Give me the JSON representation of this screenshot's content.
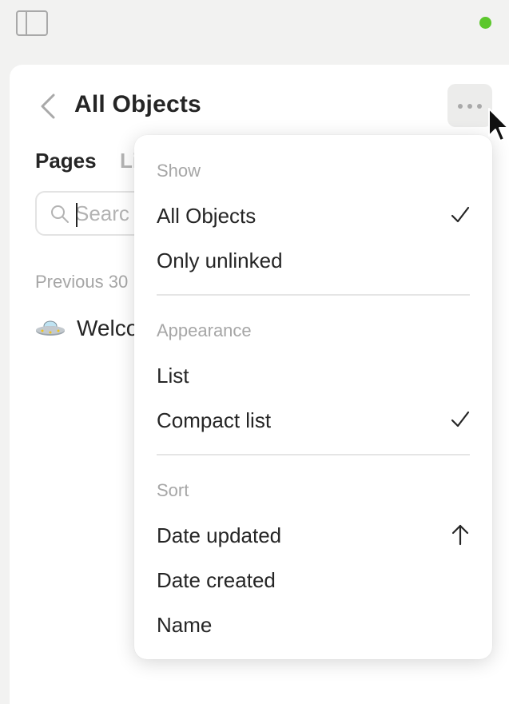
{
  "window": {
    "sidebar_toggle_icon": "sidebar-toggle-icon",
    "status_color": "#5cc72c"
  },
  "header": {
    "title": "All Objects",
    "back_icon": "chevron-left-icon",
    "more_icon": "more-horizontal-icon"
  },
  "tabs": [
    {
      "label": "Pages",
      "active": true
    },
    {
      "label": "Li",
      "active": false
    }
  ],
  "search": {
    "placeholder": "Searc",
    "value": ""
  },
  "list": {
    "section_label": "Previous 30",
    "items": [
      {
        "title": "Welco",
        "icon": "ufo-icon"
      }
    ]
  },
  "menu": {
    "groups": [
      {
        "header": "Show",
        "items": [
          {
            "label": "All Objects",
            "mark": "check"
          },
          {
            "label": "Only unlinked",
            "mark": ""
          }
        ]
      },
      {
        "header": "Appearance",
        "items": [
          {
            "label": "List",
            "mark": ""
          },
          {
            "label": "Compact list",
            "mark": "check"
          }
        ]
      },
      {
        "header": "Sort",
        "items": [
          {
            "label": "Date updated",
            "mark": "arrow-up"
          },
          {
            "label": "Date created",
            "mark": ""
          },
          {
            "label": "Name",
            "mark": ""
          }
        ]
      }
    ]
  },
  "colors": {
    "accent_text": "#252525",
    "muted_text": "#a6a6a6",
    "background": "#f2f2f1"
  }
}
